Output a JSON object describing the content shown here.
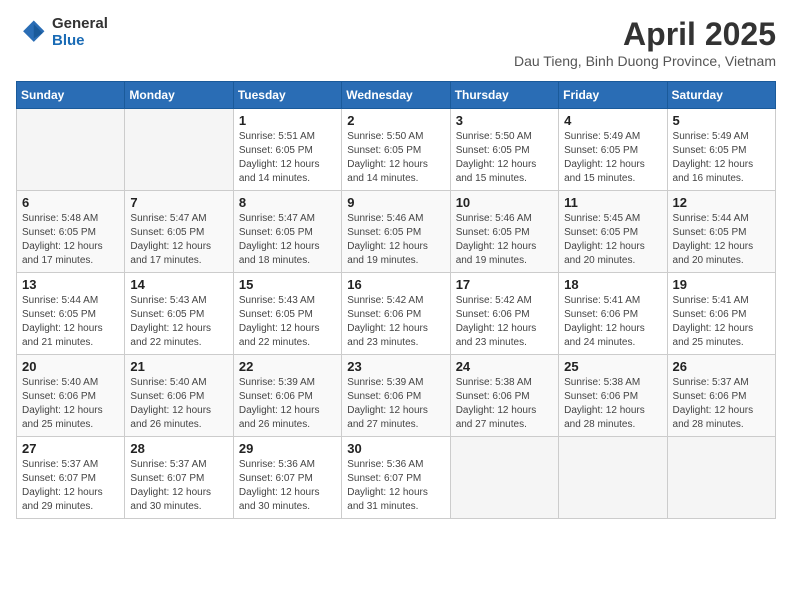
{
  "logo": {
    "general": "General",
    "blue": "Blue"
  },
  "header": {
    "month": "April 2025",
    "location": "Dau Tieng, Binh Duong Province, Vietnam"
  },
  "weekdays": [
    "Sunday",
    "Monday",
    "Tuesday",
    "Wednesday",
    "Thursday",
    "Friday",
    "Saturday"
  ],
  "weeks": [
    [
      {
        "day": "",
        "sunrise": "",
        "sunset": "",
        "daylight": "",
        "empty": true
      },
      {
        "day": "",
        "sunrise": "",
        "sunset": "",
        "daylight": "",
        "empty": true
      },
      {
        "day": "1",
        "sunrise": "Sunrise: 5:51 AM",
        "sunset": "Sunset: 6:05 PM",
        "daylight": "Daylight: 12 hours and 14 minutes."
      },
      {
        "day": "2",
        "sunrise": "Sunrise: 5:50 AM",
        "sunset": "Sunset: 6:05 PM",
        "daylight": "Daylight: 12 hours and 14 minutes."
      },
      {
        "day": "3",
        "sunrise": "Sunrise: 5:50 AM",
        "sunset": "Sunset: 6:05 PM",
        "daylight": "Daylight: 12 hours and 15 minutes."
      },
      {
        "day": "4",
        "sunrise": "Sunrise: 5:49 AM",
        "sunset": "Sunset: 6:05 PM",
        "daylight": "Daylight: 12 hours and 15 minutes."
      },
      {
        "day": "5",
        "sunrise": "Sunrise: 5:49 AM",
        "sunset": "Sunset: 6:05 PM",
        "daylight": "Daylight: 12 hours and 16 minutes."
      }
    ],
    [
      {
        "day": "6",
        "sunrise": "Sunrise: 5:48 AM",
        "sunset": "Sunset: 6:05 PM",
        "daylight": "Daylight: 12 hours and 17 minutes."
      },
      {
        "day": "7",
        "sunrise": "Sunrise: 5:47 AM",
        "sunset": "Sunset: 6:05 PM",
        "daylight": "Daylight: 12 hours and 17 minutes."
      },
      {
        "day": "8",
        "sunrise": "Sunrise: 5:47 AM",
        "sunset": "Sunset: 6:05 PM",
        "daylight": "Daylight: 12 hours and 18 minutes."
      },
      {
        "day": "9",
        "sunrise": "Sunrise: 5:46 AM",
        "sunset": "Sunset: 6:05 PM",
        "daylight": "Daylight: 12 hours and 19 minutes."
      },
      {
        "day": "10",
        "sunrise": "Sunrise: 5:46 AM",
        "sunset": "Sunset: 6:05 PM",
        "daylight": "Daylight: 12 hours and 19 minutes."
      },
      {
        "day": "11",
        "sunrise": "Sunrise: 5:45 AM",
        "sunset": "Sunset: 6:05 PM",
        "daylight": "Daylight: 12 hours and 20 minutes."
      },
      {
        "day": "12",
        "sunrise": "Sunrise: 5:44 AM",
        "sunset": "Sunset: 6:05 PM",
        "daylight": "Daylight: 12 hours and 20 minutes."
      }
    ],
    [
      {
        "day": "13",
        "sunrise": "Sunrise: 5:44 AM",
        "sunset": "Sunset: 6:05 PM",
        "daylight": "Daylight: 12 hours and 21 minutes."
      },
      {
        "day": "14",
        "sunrise": "Sunrise: 5:43 AM",
        "sunset": "Sunset: 6:05 PM",
        "daylight": "Daylight: 12 hours and 22 minutes."
      },
      {
        "day": "15",
        "sunrise": "Sunrise: 5:43 AM",
        "sunset": "Sunset: 6:05 PM",
        "daylight": "Daylight: 12 hours and 22 minutes."
      },
      {
        "day": "16",
        "sunrise": "Sunrise: 5:42 AM",
        "sunset": "Sunset: 6:06 PM",
        "daylight": "Daylight: 12 hours and 23 minutes."
      },
      {
        "day": "17",
        "sunrise": "Sunrise: 5:42 AM",
        "sunset": "Sunset: 6:06 PM",
        "daylight": "Daylight: 12 hours and 23 minutes."
      },
      {
        "day": "18",
        "sunrise": "Sunrise: 5:41 AM",
        "sunset": "Sunset: 6:06 PM",
        "daylight": "Daylight: 12 hours and 24 minutes."
      },
      {
        "day": "19",
        "sunrise": "Sunrise: 5:41 AM",
        "sunset": "Sunset: 6:06 PM",
        "daylight": "Daylight: 12 hours and 25 minutes."
      }
    ],
    [
      {
        "day": "20",
        "sunrise": "Sunrise: 5:40 AM",
        "sunset": "Sunset: 6:06 PM",
        "daylight": "Daylight: 12 hours and 25 minutes."
      },
      {
        "day": "21",
        "sunrise": "Sunrise: 5:40 AM",
        "sunset": "Sunset: 6:06 PM",
        "daylight": "Daylight: 12 hours and 26 minutes."
      },
      {
        "day": "22",
        "sunrise": "Sunrise: 5:39 AM",
        "sunset": "Sunset: 6:06 PM",
        "daylight": "Daylight: 12 hours and 26 minutes."
      },
      {
        "day": "23",
        "sunrise": "Sunrise: 5:39 AM",
        "sunset": "Sunset: 6:06 PM",
        "daylight": "Daylight: 12 hours and 27 minutes."
      },
      {
        "day": "24",
        "sunrise": "Sunrise: 5:38 AM",
        "sunset": "Sunset: 6:06 PM",
        "daylight": "Daylight: 12 hours and 27 minutes."
      },
      {
        "day": "25",
        "sunrise": "Sunrise: 5:38 AM",
        "sunset": "Sunset: 6:06 PM",
        "daylight": "Daylight: 12 hours and 28 minutes."
      },
      {
        "day": "26",
        "sunrise": "Sunrise: 5:37 AM",
        "sunset": "Sunset: 6:06 PM",
        "daylight": "Daylight: 12 hours and 28 minutes."
      }
    ],
    [
      {
        "day": "27",
        "sunrise": "Sunrise: 5:37 AM",
        "sunset": "Sunset: 6:07 PM",
        "daylight": "Daylight: 12 hours and 29 minutes."
      },
      {
        "day": "28",
        "sunrise": "Sunrise: 5:37 AM",
        "sunset": "Sunset: 6:07 PM",
        "daylight": "Daylight: 12 hours and 30 minutes."
      },
      {
        "day": "29",
        "sunrise": "Sunrise: 5:36 AM",
        "sunset": "Sunset: 6:07 PM",
        "daylight": "Daylight: 12 hours and 30 minutes."
      },
      {
        "day": "30",
        "sunrise": "Sunrise: 5:36 AM",
        "sunset": "Sunset: 6:07 PM",
        "daylight": "Daylight: 12 hours and 31 minutes."
      },
      {
        "day": "",
        "sunrise": "",
        "sunset": "",
        "daylight": "",
        "empty": true
      },
      {
        "day": "",
        "sunrise": "",
        "sunset": "",
        "daylight": "",
        "empty": true
      },
      {
        "day": "",
        "sunrise": "",
        "sunset": "",
        "daylight": "",
        "empty": true
      }
    ]
  ]
}
